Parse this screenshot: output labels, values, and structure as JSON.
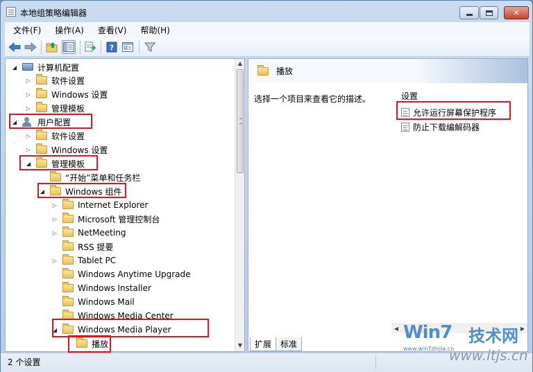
{
  "window": {
    "title": "本地组策略编辑器",
    "controls": {
      "minimize": "",
      "maximize": "",
      "close": "✕"
    }
  },
  "menu": [
    {
      "label": "文件(F)"
    },
    {
      "label": "操作(A)"
    },
    {
      "label": "查看(V)"
    },
    {
      "label": "帮助(H)"
    }
  ],
  "toolbar": {
    "icons": [
      "back-arrow-icon",
      "forward-arrow-icon",
      "up-folder-icon",
      "show-hide-tree-icon",
      "export-list-icon",
      "help-icon",
      "properties-icon",
      "filter-icon"
    ]
  },
  "tree": [
    {
      "label": "计算机配置",
      "icon": "computer-icon",
      "expanded": true
    },
    {
      "label": "软件设置",
      "icon": "folder-icon",
      "expanded": false
    },
    {
      "label": "Windows 设置",
      "icon": "folder-icon",
      "expanded": false
    },
    {
      "label": "管理模板",
      "icon": "folder-icon",
      "expanded": false
    },
    {
      "label": "用户配置",
      "icon": "user-icon",
      "expanded": true
    },
    {
      "label": "软件设置",
      "icon": "folder-icon",
      "expanded": false
    },
    {
      "label": "Windows 设置",
      "icon": "folder-icon",
      "expanded": false
    },
    {
      "label": "管理模板",
      "icon": "folder-icon",
      "expanded": true
    },
    {
      "label": "“开始”菜单和任务栏",
      "icon": "folder-icon"
    },
    {
      "label": "Windows 组件",
      "icon": "folder-icon",
      "expanded": true
    },
    {
      "label": "Internet Explorer",
      "icon": "folder-icon",
      "expanded": false
    },
    {
      "label": "Microsoft 管理控制台",
      "icon": "folder-icon",
      "expanded": false
    },
    {
      "label": "NetMeeting",
      "icon": "folder-icon",
      "expanded": false
    },
    {
      "label": "RSS 提要",
      "icon": "folder-icon"
    },
    {
      "label": "Tablet PC",
      "icon": "folder-icon",
      "expanded": false
    },
    {
      "label": "Windows Anytime Upgrade",
      "icon": "folder-icon"
    },
    {
      "label": "Windows Installer",
      "icon": "folder-icon"
    },
    {
      "label": "Windows Mail",
      "icon": "folder-icon"
    },
    {
      "label": "Windows Media Center",
      "icon": "folder-icon"
    },
    {
      "label": "Windows Media Player",
      "icon": "folder-icon",
      "expanded": true
    },
    {
      "label": "播放",
      "icon": "folder-icon",
      "selected": true
    }
  ],
  "details": {
    "title": "播放",
    "description": "选择一个项目来查看它的描述。",
    "column_header": "设置",
    "settings": [
      {
        "label": "允许运行屏幕保护程序"
      },
      {
        "label": "防止下载编解码器"
      }
    ],
    "tabs": [
      {
        "label": "扩展",
        "active": true
      },
      {
        "label": "标准",
        "active": false
      }
    ]
  },
  "status": {
    "text": "2 个设置"
  },
  "watermark": {
    "logo": "Win7",
    "tech": "技术网",
    "url_small": "www.win7zhijia.cn",
    "url_large": "www.itjs.cn"
  },
  "highlight_color": "#e0141a"
}
